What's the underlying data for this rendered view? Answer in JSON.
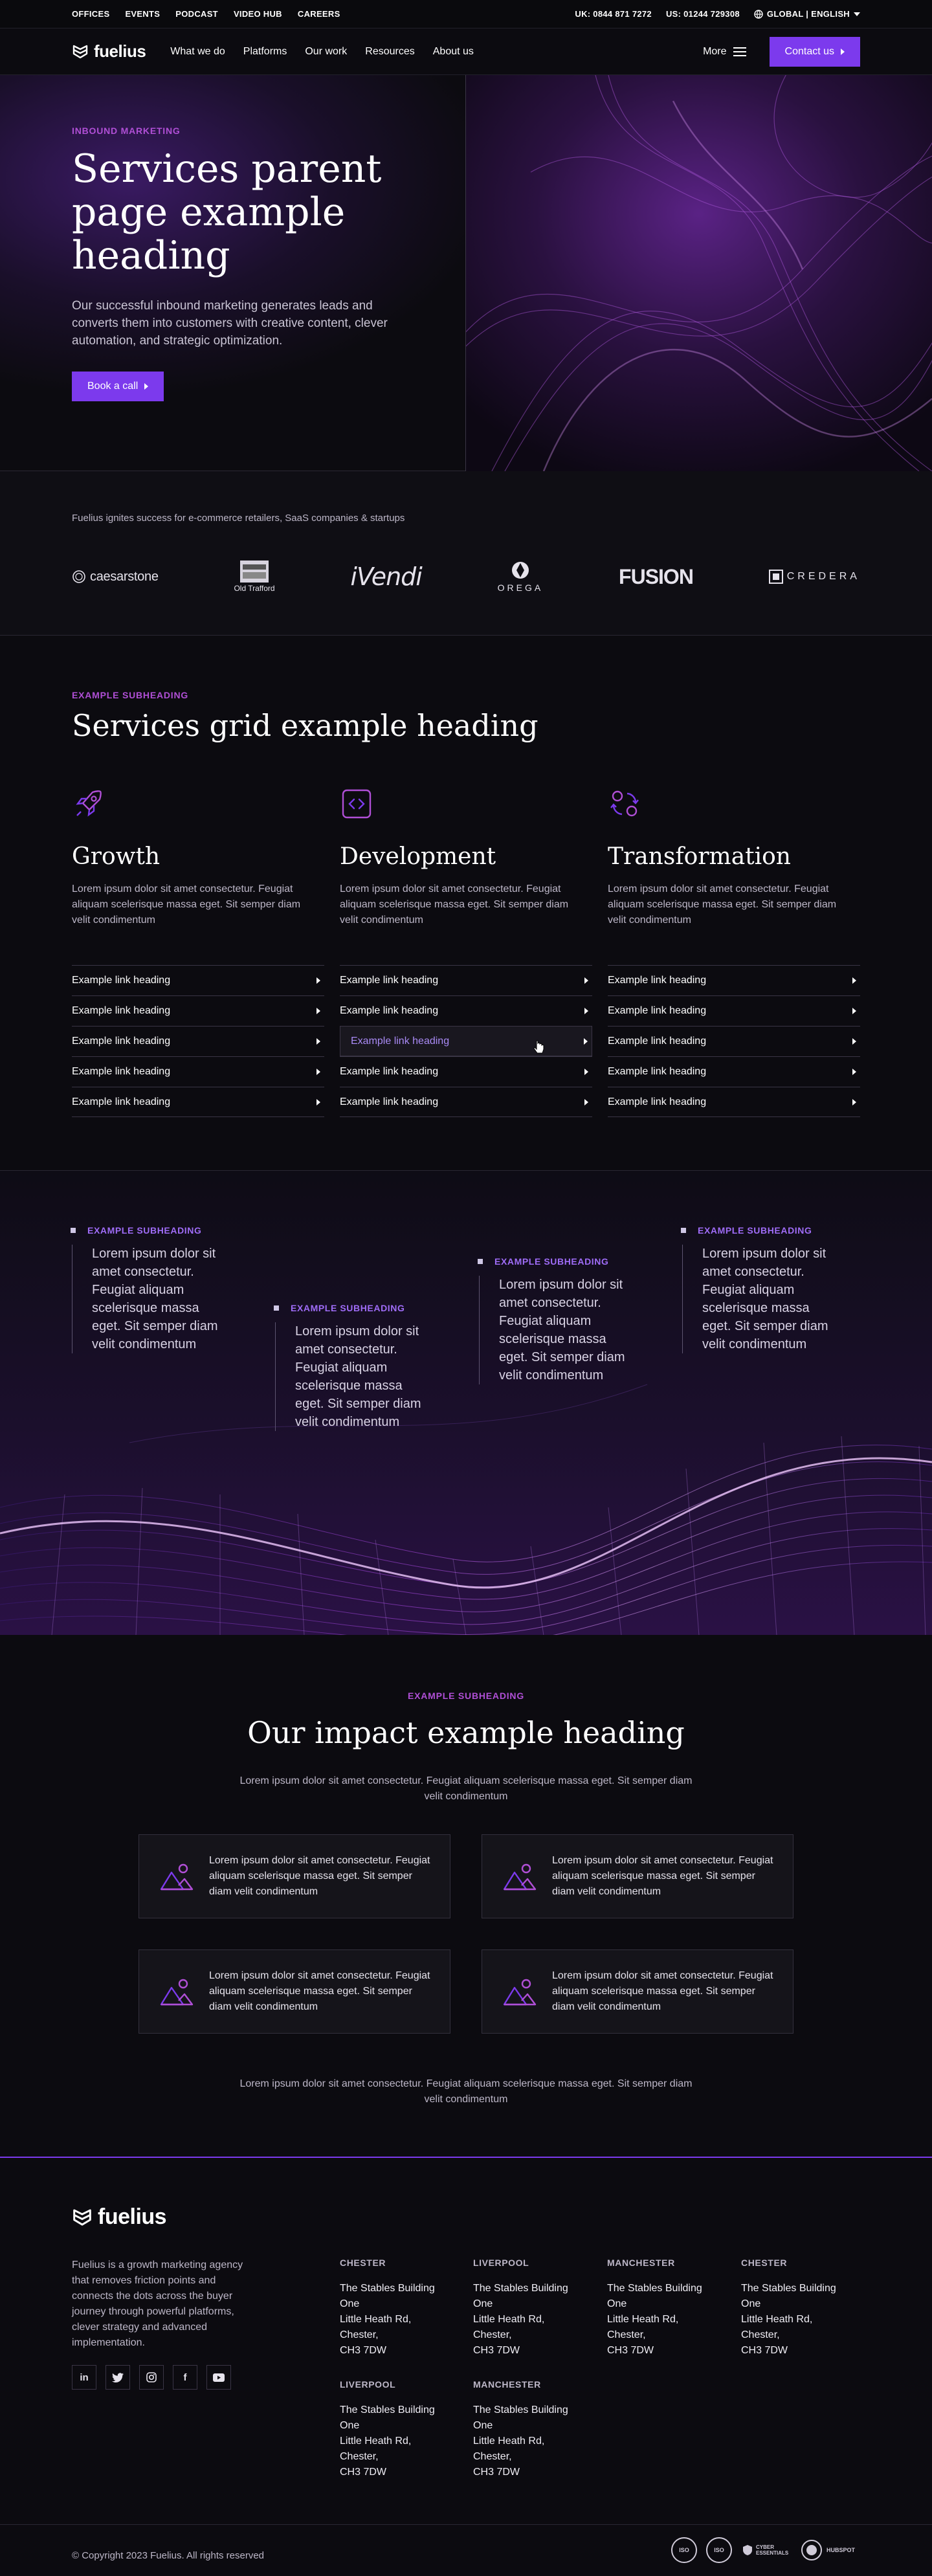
{
  "utility": {
    "links": [
      "OFFICES",
      "EVENTS",
      "PODCAST",
      "VIDEO HUB",
      "CAREERS"
    ],
    "phone_uk": "UK: 0844 871 7272",
    "phone_us": "US: 01244 729308",
    "locale": "GLOBAL | ENGLISH"
  },
  "nav": {
    "logo": "fuelius",
    "links": [
      "What we do",
      "Platforms",
      "Our work",
      "Resources",
      "About us"
    ],
    "more": "More",
    "contact": "Contact us"
  },
  "hero": {
    "eyebrow": "INBOUND MARKETING",
    "title": "Services parent page example heading",
    "body": "Our successful inbound marketing generates leads and converts them into customers with creative content, clever automation, and strategic optimization.",
    "cta": "Book a call"
  },
  "clients": {
    "caption": "Fuelius ignites success for e-commerce retailers, SaaS companies & startups",
    "logos": [
      "caesarstone",
      "Old Trafford",
      "iVendi",
      "OREGA",
      "FUSION",
      "CREDERA"
    ]
  },
  "services": {
    "eyebrow": "EXAMPLE SUBHEADING",
    "title": "Services grid example heading",
    "columns": [
      {
        "icon": "rocket-icon",
        "title": "Growth",
        "body": "Lorem ipsum dolor sit amet consectetur. Feugiat aliquam scelerisque massa eget. Sit semper diam velit condimentum"
      },
      {
        "icon": "code-icon",
        "title": "Development",
        "body": "Lorem ipsum dolor sit amet consectetur. Feugiat aliquam scelerisque massa eget. Sit semper diam velit condimentum"
      },
      {
        "icon": "refresh-icon",
        "title": "Transformation",
        "body": "Lorem ipsum dolor sit amet consectetur. Feugiat aliquam scelerisque massa eget. Sit semper diam velit condimentum"
      }
    ],
    "link_label": "Example link heading"
  },
  "stats": [
    {
      "title": "EXAMPLE SUBHEADING",
      "body": "Lorem ipsum dolor sit amet consectetur. Feugiat aliquam scelerisque massa eget. Sit semper diam velit condimentum"
    },
    {
      "title": "EXAMPLE SUBHEADING",
      "body": "Lorem ipsum dolor sit amet consectetur. Feugiat aliquam scelerisque massa eget. Sit semper diam velit condimentum"
    },
    {
      "title": "EXAMPLE SUBHEADING",
      "body": "Lorem ipsum dolor sit amet consectetur. Feugiat aliquam scelerisque massa eget. Sit semper diam velit condimentum"
    },
    {
      "title": "EXAMPLE SUBHEADING",
      "body": "Lorem ipsum dolor sit amet consectetur. Feugiat aliquam scelerisque massa eget. Sit semper diam velit condimentum"
    }
  ],
  "impact": {
    "eyebrow": "EXAMPLE SUBHEADING",
    "title": "Our impact example heading",
    "lead": "Lorem ipsum dolor sit amet consectetur. Feugiat aliquam scelerisque massa eget. Sit semper diam velit condimentum",
    "card_text": "Lorem ipsum dolor sit amet consectetur. Feugiat aliquam scelerisque massa eget. Sit semper diam velit condimentum",
    "footnote": "Lorem ipsum dolor sit amet consectetur. Feugiat aliquam scelerisque massa eget. Sit semper diam velit condimentum"
  },
  "footer": {
    "logo": "fuelius",
    "about": "Fuelius is a growth marketing agency that removes friction points and connects the dots across the buyer journey through powerful platforms, clever strategy and advanced implementation.",
    "social": [
      "in",
      "t",
      "◎",
      "f",
      "▶"
    ],
    "offices": [
      {
        "city": "CHESTER",
        "address": "The Stables Building One\nLittle Heath Rd,\nChester,\nCH3 7DW"
      },
      {
        "city": "LIVERPOOL",
        "address": "The Stables Building One\nLittle Heath Rd,\nChester,\nCH3 7DW"
      },
      {
        "city": "MANCHESTER",
        "address": "The Stables Building One\nLittle Heath Rd,\nChester,\nCH3 7DW"
      },
      {
        "city": "CHESTER",
        "address": "The Stables Building One\nLittle Heath Rd,\nChester,\nCH3 7DW"
      },
      {
        "city": "LIVERPOOL",
        "address": "The Stables Building One\nLittle Heath Rd,\nChester,\nCH3 7DW"
      },
      {
        "city": "MANCHESTER",
        "address": "The Stables Building One\nLittle Heath Rd,\nChester,\nCH3 7DW"
      }
    ],
    "copyright": "© Copyright 2023 Fuelius. All rights reserved",
    "badges": [
      "ISO",
      "ISO",
      "CYBER ESSENTIALS",
      "HUBSPOT"
    ]
  },
  "colors": {
    "accent": "#7c3aed",
    "eyebrow": "#b04fd6",
    "background": "#0c0b10"
  }
}
